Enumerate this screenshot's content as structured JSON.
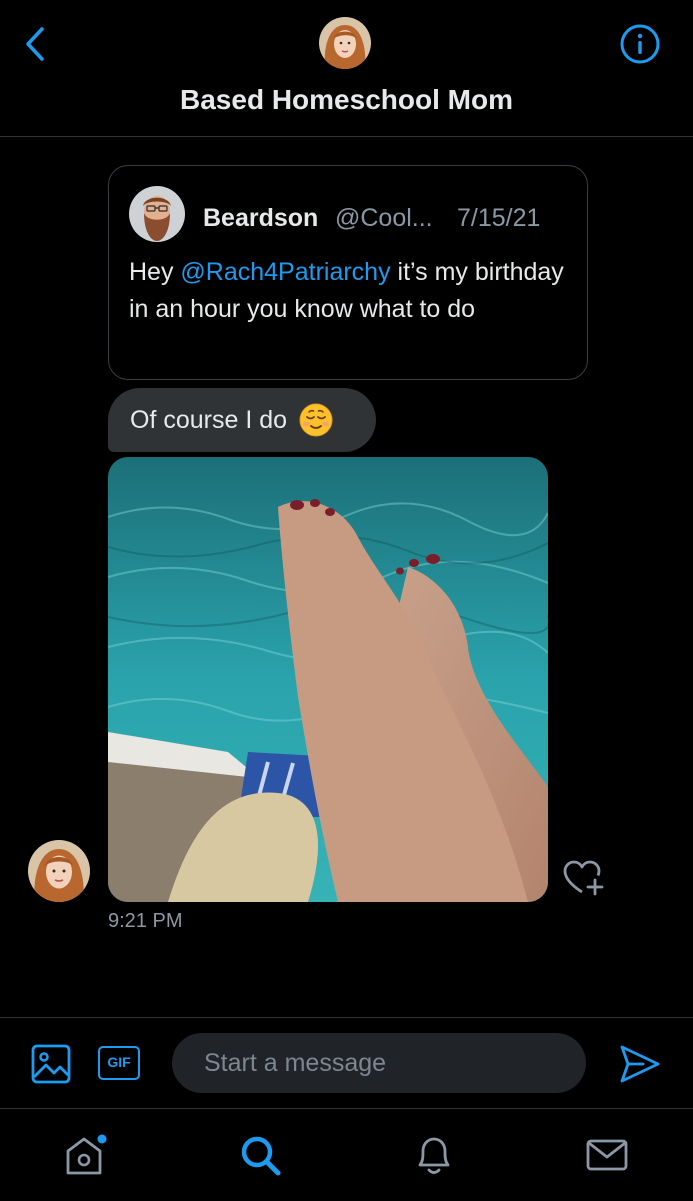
{
  "header": {
    "title": "Based Homeschool Mom",
    "back_icon": "chevron-left-icon",
    "info_icon": "info-icon"
  },
  "quoted_tweet": {
    "author_name": "Beardson",
    "author_handle": "@Cool...",
    "date": "7/15/21",
    "text_before": "Hey ",
    "mention": "@Rach4Patriarchy",
    "text_after": " it’s my birthday in an hour you know what to do"
  },
  "message": {
    "text": "Of course I do",
    "emoji": "relieved-face-emoji",
    "time": "9:21 PM"
  },
  "composer": {
    "placeholder": "Start a message",
    "gif_label": "GIF"
  },
  "bottom_nav": {
    "items": [
      "home-icon",
      "search-icon",
      "bell-icon",
      "mail-icon"
    ]
  },
  "colors": {
    "accent": "#1d9bf0",
    "background": "#000000",
    "bubble": "#2f3336",
    "text_secondary": "#8b98a5"
  }
}
